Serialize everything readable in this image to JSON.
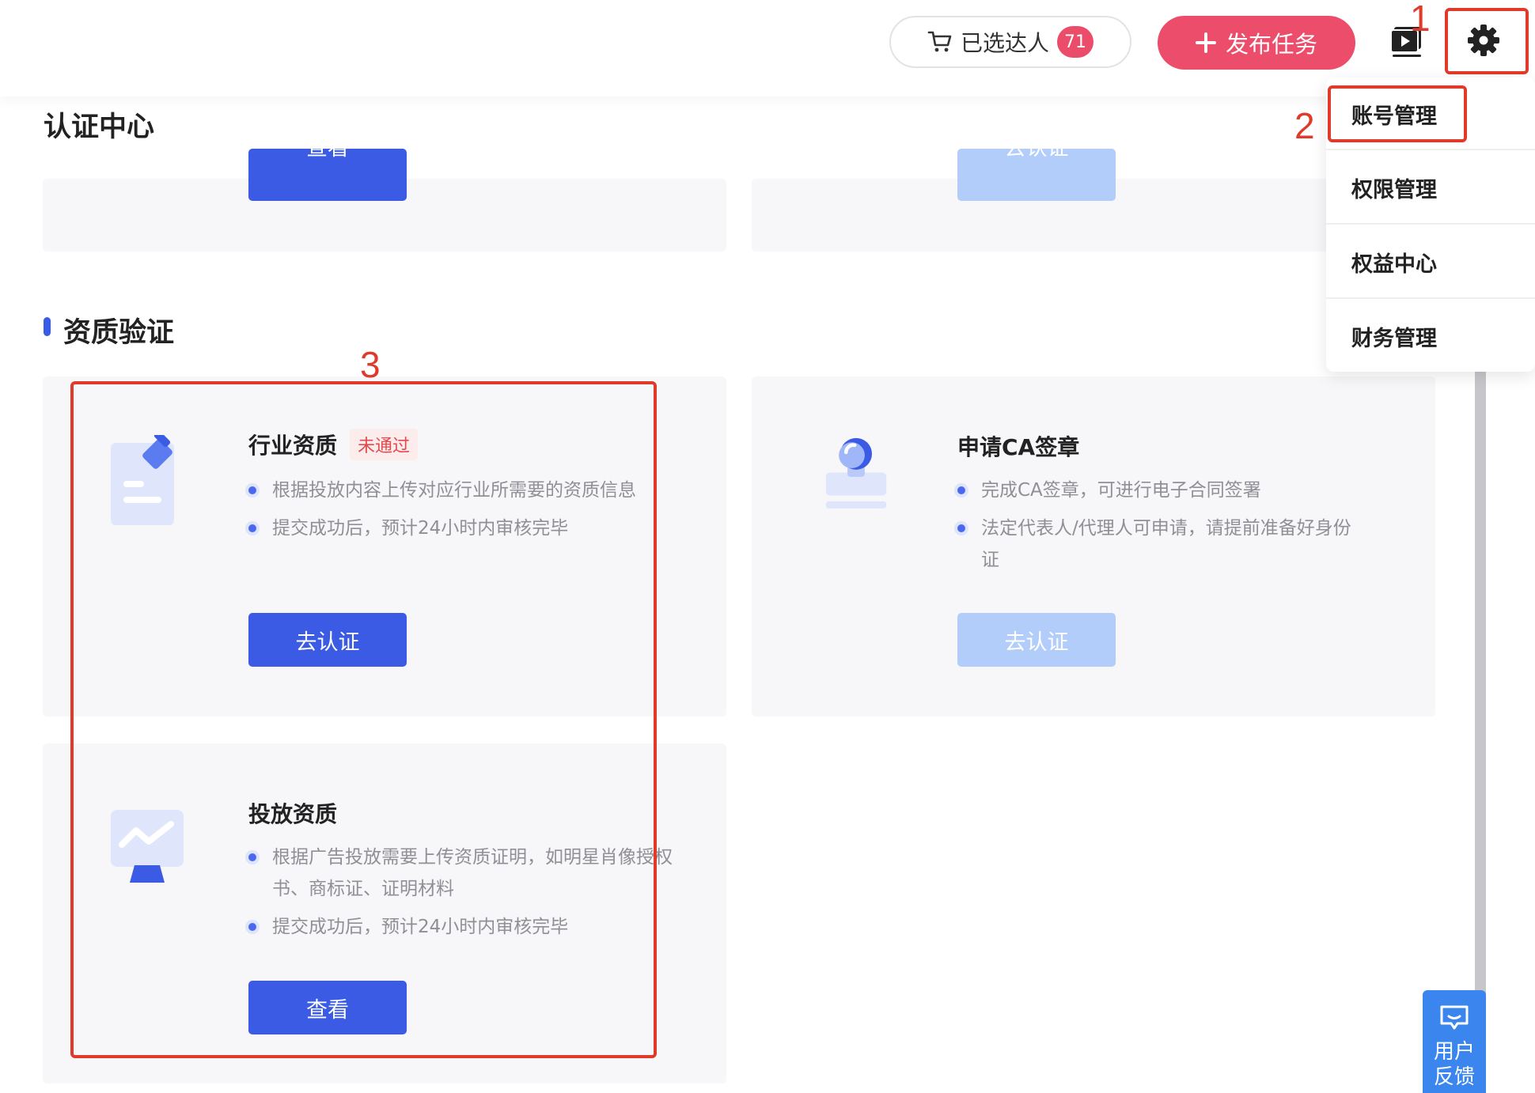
{
  "header": {
    "cart_label": "已选达人",
    "cart_count": "71",
    "publish_label": "发布任务",
    "icons": [
      "cart-icon",
      "plus-icon",
      "video-icon",
      "gear-icon"
    ]
  },
  "dropdown": {
    "items": [
      "账号管理",
      "权限管理",
      "权益中心",
      "财务管理"
    ]
  },
  "page": {
    "title": "认证中心",
    "top_card_buttons": [
      "查看",
      "去认证"
    ]
  },
  "section": {
    "title": "资质验证"
  },
  "cards": [
    {
      "title": "行业资质",
      "status": "未通过",
      "bullets": [
        "根据投放内容上传对应行业所需要的资质信息",
        "提交成功后，预计24小时内审核完毕"
      ],
      "button": "去认证"
    },
    {
      "title": "申请CA签章",
      "bullets": [
        "完成CA签章，可进行电子合同签署",
        "法定代表人/代理人可申请，请提前准备好身份证"
      ],
      "button": "去认证"
    },
    {
      "title": "投放资质",
      "bullets": [
        "根据广告投放需要上传资质证明，如明星肖像授权书、商标证、证明材料",
        "提交成功后，预计24小时内审核完毕"
      ],
      "button": "查看"
    }
  ],
  "annotations": [
    "1",
    "2",
    "3"
  ],
  "feedback": {
    "label": "用户反馈"
  },
  "colors": {
    "accent": "#3b5be5",
    "publish": "#ec4d6b",
    "annotation": "#e03a2b",
    "status_fail": "#e5484d"
  }
}
